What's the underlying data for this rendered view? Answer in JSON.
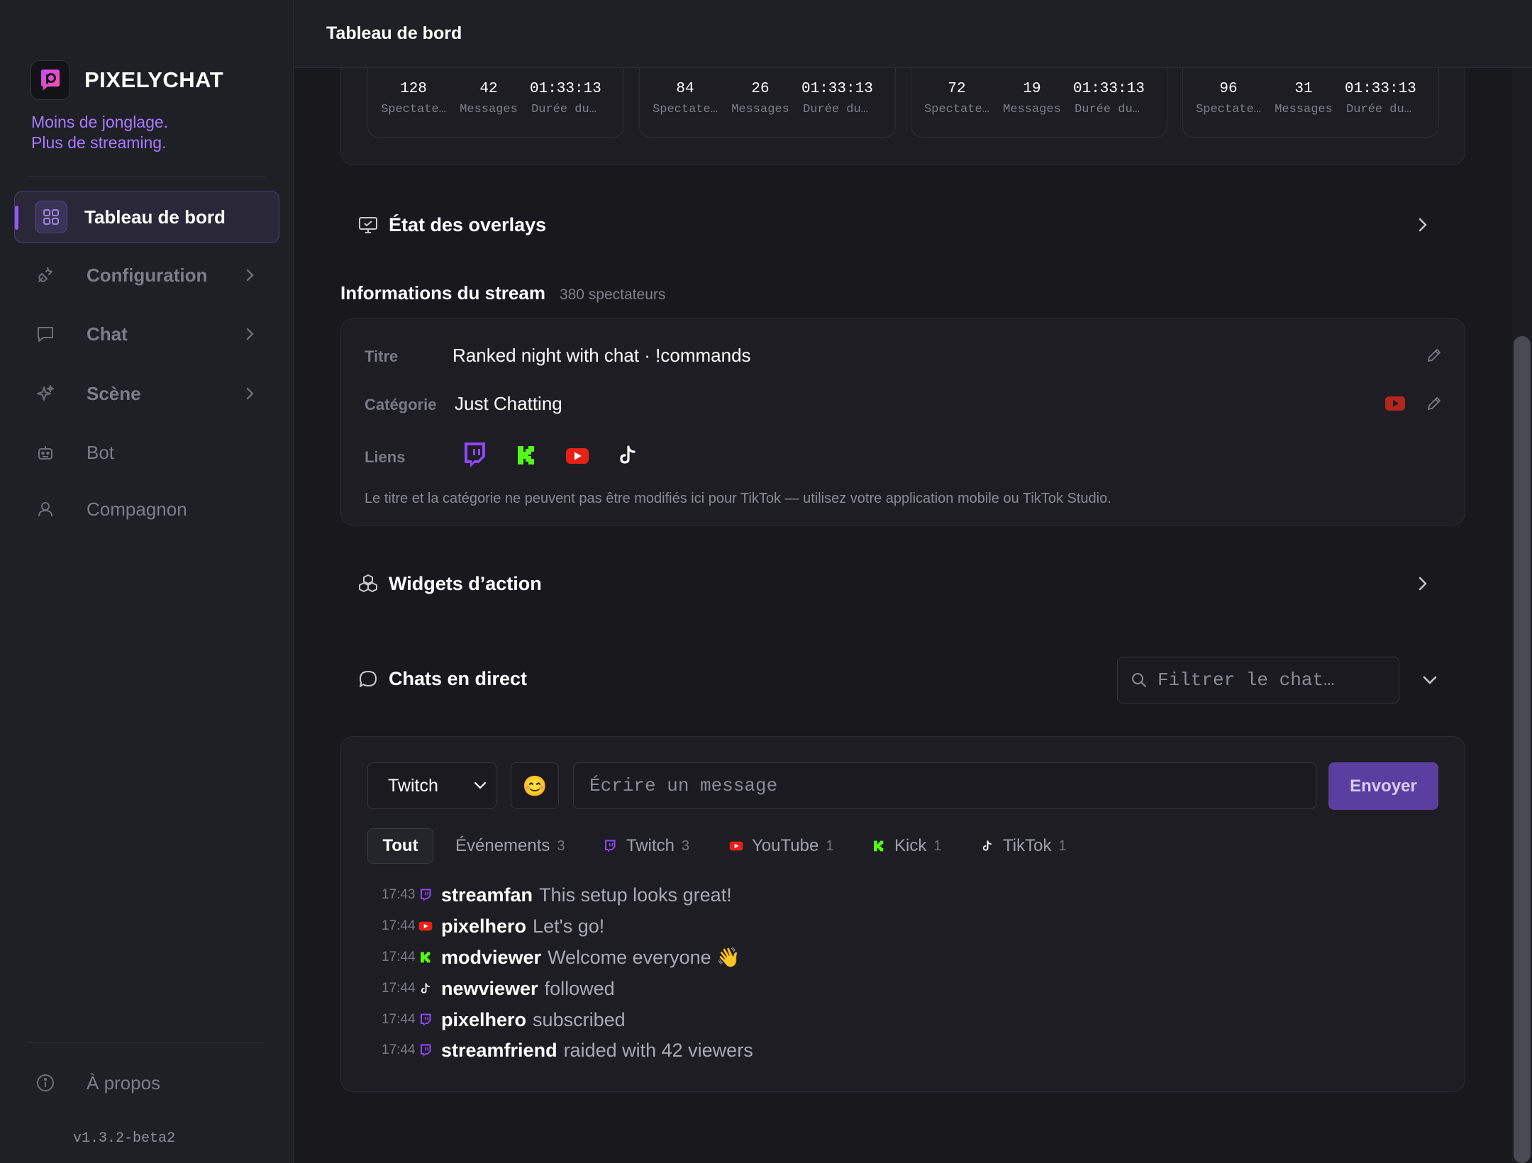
{
  "app": {
    "brand": "PIXELYCHAT",
    "tagline_line1": "Moins de jonglage.",
    "tagline_line2": "Plus de streaming.",
    "version": "v1.3.2-beta2",
    "accent_color": "#8c5cf5"
  },
  "sidebar": {
    "items": [
      {
        "label": "Tableau de bord",
        "icon": "grid-icon",
        "active": true
      },
      {
        "label": "Configuration",
        "icon": "plug-icon",
        "has_submenu": true
      },
      {
        "label": "Chat",
        "icon": "chat-bubble-icon",
        "has_submenu": true
      },
      {
        "label": "Scène",
        "icon": "sparkles-icon",
        "has_submenu": true
      },
      {
        "label": "Bot",
        "icon": "robot-icon"
      },
      {
        "label": "Compagnon",
        "icon": "user-icon"
      }
    ],
    "about": {
      "label": "À propos",
      "icon": "info-icon"
    }
  },
  "header": {
    "title": "Tableau de bord"
  },
  "stats_cards": [
    {
      "spectators": "128",
      "messages": "42",
      "duration": "01:33:13",
      "spectators_label": "Spectate…",
      "messages_label": "Messages",
      "duration_label": "Durée du…"
    },
    {
      "spectators": "84",
      "messages": "26",
      "duration": "01:33:13",
      "spectators_label": "Spectate…",
      "messages_label": "Messages",
      "duration_label": "Durée du…"
    },
    {
      "spectators": "72",
      "messages": "19",
      "duration": "01:33:13",
      "spectators_label": "Spectate…",
      "messages_label": "Messages",
      "duration_label": "Durée du…"
    },
    {
      "spectators": "96",
      "messages": "31",
      "duration": "01:33:13",
      "spectators_label": "Spectate…",
      "messages_label": "Messages",
      "duration_label": "Durée du…"
    }
  ],
  "overlays": {
    "title": "État des overlays"
  },
  "stream_info": {
    "title": "Informations du stream",
    "viewers": "380 spectateurs",
    "title_label": "Titre",
    "title_value": "Ranked night with chat · !commands",
    "category_label": "Catégorie",
    "category_value": "Just Chatting",
    "links_label": "Liens",
    "links": [
      "twitch",
      "kick",
      "youtube",
      "tiktok"
    ],
    "note": "Le titre et la catégorie ne peuvent pas être modifiés ici pour TikTok — utilisez votre application mobile ou TikTok Studio."
  },
  "widgets": {
    "title": "Widgets d’action"
  },
  "live_chat": {
    "title": "Chats en direct",
    "filter_placeholder": "Filtrer le chat…",
    "platform_select": "Twitch",
    "emoji": "😊",
    "message_placeholder": "Écrire un message",
    "send_label": "Envoyer",
    "tabs": [
      {
        "label": "Tout",
        "count": ""
      },
      {
        "label": "Événements",
        "count": "3"
      },
      {
        "label": "Twitch",
        "count": "3",
        "platform": "twitch"
      },
      {
        "label": "YouTube",
        "count": "1",
        "platform": "youtube"
      },
      {
        "label": "Kick",
        "count": "1",
        "platform": "kick"
      },
      {
        "label": "TikTok",
        "count": "1",
        "platform": "tiktok"
      }
    ],
    "messages": [
      {
        "time": "17:43",
        "platform": "twitch",
        "user": "streamfan",
        "text": "This setup looks great!"
      },
      {
        "time": "17:44",
        "platform": "youtube",
        "user": "pixelhero",
        "text": "Let's go!"
      },
      {
        "time": "17:44",
        "platform": "kick",
        "user": "modviewer",
        "text": "Welcome everyone 👋"
      },
      {
        "time": "17:44",
        "platform": "tiktok",
        "user": "newviewer",
        "text": "followed"
      },
      {
        "time": "17:44",
        "platform": "twitch",
        "user": "pixelhero",
        "text": "subscribed"
      },
      {
        "time": "17:44",
        "platform": "twitch",
        "user": "streamfriend",
        "text": "raided with 42 viewers"
      }
    ]
  },
  "colors": {
    "twitch": "#9146ff",
    "youtube": "#e62117",
    "kick": "#53fc18",
    "tiktok": "#ffffff"
  }
}
